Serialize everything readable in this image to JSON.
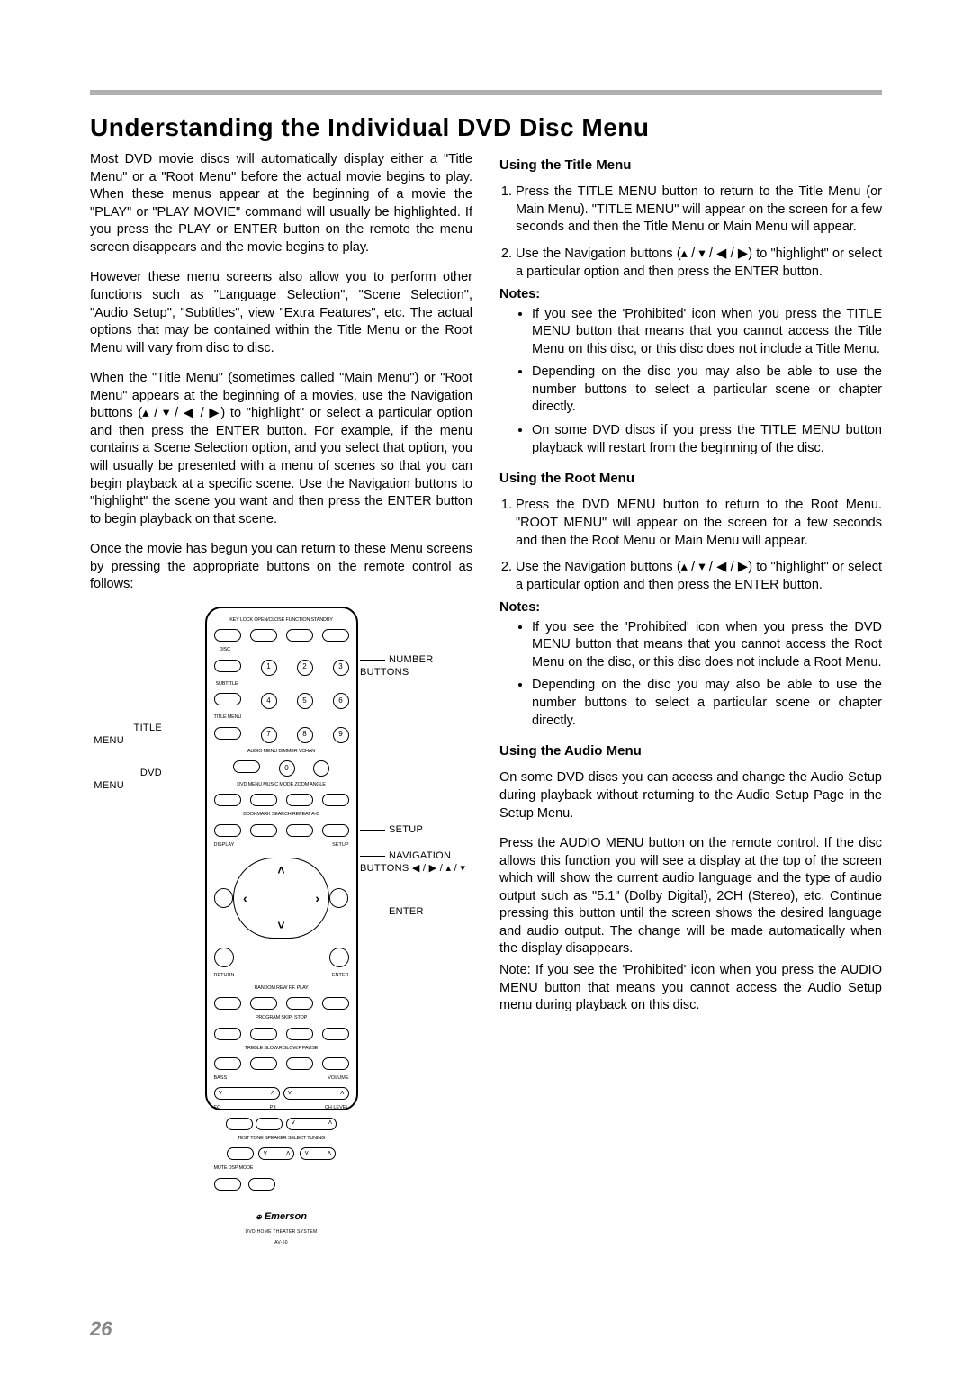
{
  "page_number": "26",
  "title": "Understanding the Individual DVD Disc Menu",
  "left_col": {
    "p1": "Most DVD movie discs will automatically display either a \"Title Menu\" or a \"Root Menu\" before the actual movie begins to play. When these menus appear at the beginning of a movie the \"PLAY\" or \"PLAY MOVIE\" command will usually be highlighted. If you press the PLAY or ENTER button on the remote the menu screen disappears and the movie begins to play.",
    "p2": "However these menu screens also allow you to perform other functions such as \"Language Selection\", \"Scene Selection\", \"Audio Setup\", \"Subtitles\", view \"Extra Features\", etc. The actual options that may be contained within the Title Menu or the Root Menu will vary from disc to disc.",
    "p3a": "When the \"Title Menu\" (sometimes called \"Main Menu\") or \"Root Menu\" appears at the beginning of a movies, use the Navigation buttons (",
    "p3b": ") to \"highlight\" or select a particular option and then press the ENTER button. For example, if the menu contains a Scene Selection option, and you select that option, you will usually be presented with a menu of scenes so that you can begin playback at a specific scene. Use the Navigation buttons to \"highlight\" the scene you want and then press the ENTER button to begin playback on that scene.",
    "p4": "Once the movie has begun you can return to these Menu screens by pressing the appropriate buttons on the remote control as follows:"
  },
  "remote": {
    "row1_labels": "KEY LOCK   OPEN/CLOSE   FUNCTION   STANDBY",
    "disc_label": "DISC",
    "subtitle_label": "SUBTITLE",
    "titlemenu_label": "TITLE MENU",
    "row_tm_labels": "AUDIO MENU   DIMMER   VCHAN",
    "dvdmenu_label": "DVD MENU   MUSIC MODE   ZOOM   ANGLE",
    "bookmark_label": "BOOKMARK   SEARCH   REPEAT   A-B",
    "display_label": "DISPLAY",
    "setup_label": "SETUP",
    "return_label": "RETURN",
    "enter_label": "ENTER",
    "play_row": "RANDOM   REW   F.F.   PLAY",
    "stop_row": "PROGRAM   SKIP-   STOP",
    "pause_row": "TREBLE   SLOW.R   SLOW.F   PAUSE",
    "bass_label": "BASS",
    "volume_label": "VOLUME",
    "eq_label": "EQ",
    "p3_label": "P3",
    "chlevel_label": "CH LEVEL",
    "testtone_label": "TEST TONE   SPEAKER SELECT   TUNING",
    "mute_label": "MUTE   DSP MODE",
    "brand": "Emerson",
    "brand_sub": "DVD HOME THEATER SYSTEM",
    "model": "AV-50"
  },
  "callouts": {
    "title_menu": "TITLE\nMENU",
    "dvd_menu": "DVD\nMENU",
    "number_buttons": "NUMBER\nBUTTONS",
    "setup": "SETUP",
    "navigation": "NAVIGATION\nBUTTONS ◀ / ▶ / ▴ / ▾",
    "enter": "ENTER"
  },
  "right_col": {
    "h_title": "Using the Title Menu",
    "title_ol1": "Press the TITLE MENU button to return to the Title Menu (or Main Menu). \"TITLE MENU\" will appear on the screen for a few seconds and then the Title Menu or Main Menu will appear.",
    "title_ol2a": "Use the Navigation buttons (",
    "title_ol2b": ") to \"highlight\" or select a particular option and then press the ENTER button.",
    "notes_label": "Notes:",
    "title_notes": [
      "If you see the 'Prohibited' icon when you press the TITLE MENU button that means that you cannot access the Title Menu on this disc, or this disc does not include a Title Menu.",
      "Depending on the disc you may also be able to use the number buttons to select a particular scene or chapter directly.",
      "On some DVD discs if you press the TITLE MENU button playback will restart from the beginning of the disc."
    ],
    "h_root": "Using the Root Menu",
    "root_ol1": "Press the DVD MENU button to return to the Root Menu. \"ROOT MENU\" will appear on the screen for a few seconds and then the Root Menu or Main Menu will appear.",
    "root_ol2a": "Use the Navigation buttons (",
    "root_ol2b": ") to \"highlight\" or select a particular option and then press the ENTER button.",
    "root_notes": [
      "If you see the 'Prohibited' icon when you press the DVD MENU button that means that you cannot access the Root Menu on the disc, or this disc does not include a Root Menu.",
      "Depending on the disc you may also be able to use the number buttons to select a particular scene or chapter directly."
    ],
    "h_audio": "Using the Audio Menu",
    "audio_p1": "On some DVD discs you can access and change the Audio Setup during playback without returning to the Audio Setup Page in the Setup Menu.",
    "audio_p2": "Press the AUDIO MENU button on the remote control. If the disc allows this function you will see a display at the top of the screen which will show the current audio language and the type of audio output such as \"5.1\" (Dolby Digital), 2CH (Stereo), etc. Continue pressing this button until the screen shows the desired language and audio output. The change will be made automatically when the display disappears.",
    "audio_note": "Note: If you see the 'Prohibited' icon when you press the AUDIO MENU button that means you cannot access the Audio Setup menu during playback on this disc."
  },
  "arrows": "▴ / ▾ / ◀ / ▶"
}
